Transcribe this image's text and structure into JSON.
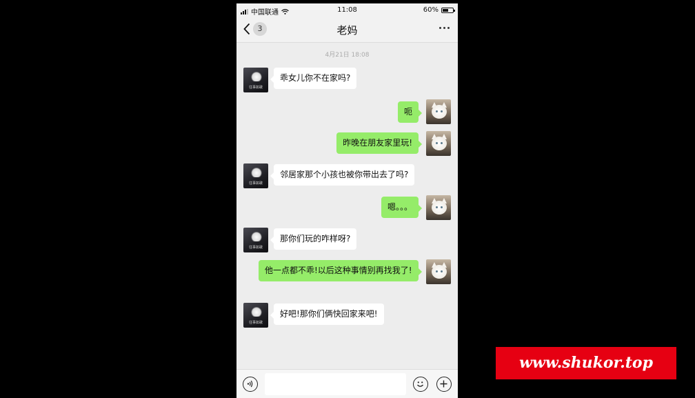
{
  "status_bar": {
    "carrier": "中国联通",
    "time": "11:08",
    "battery": "60%",
    "battery_level": 0.6
  },
  "nav": {
    "unread_count": "3",
    "title": "老妈",
    "back_icon": "chevron-left-icon",
    "more_icon": "more-dots-icon"
  },
  "chat": {
    "timestamp": "4月21日 18:08",
    "messages": [
      {
        "side": "left",
        "text": "乖女儿你不在家吗?"
      },
      {
        "side": "right",
        "text": "呃"
      },
      {
        "side": "right",
        "text": "昨晚在朋友家里玩!"
      },
      {
        "side": "left",
        "text": "邻居家那个小孩也被你带出去了吗?"
      },
      {
        "side": "right",
        "text": "嗯。。。"
      },
      {
        "side": "left",
        "text": "那你们玩的咋样呀?"
      },
      {
        "side": "right",
        "text": "他一点都不乖!以后这种事情别再找我了!"
      },
      {
        "side": "left",
        "text": "好吧!那你们俩快回家来吧!"
      }
    ]
  },
  "avatars": {
    "mom_caption": "往事如歌"
  },
  "input_bar": {
    "value": "",
    "voice_icon": "voice-icon",
    "emoji_icon": "emoji-icon",
    "plus_icon": "plus-icon"
  },
  "watermark": {
    "text": "www.shukor.top"
  },
  "colors": {
    "background": "#000000",
    "chat_background": "#ededed",
    "bubble_sent": "#95ec69",
    "bubble_received": "#ffffff",
    "watermark": "#e60012"
  }
}
